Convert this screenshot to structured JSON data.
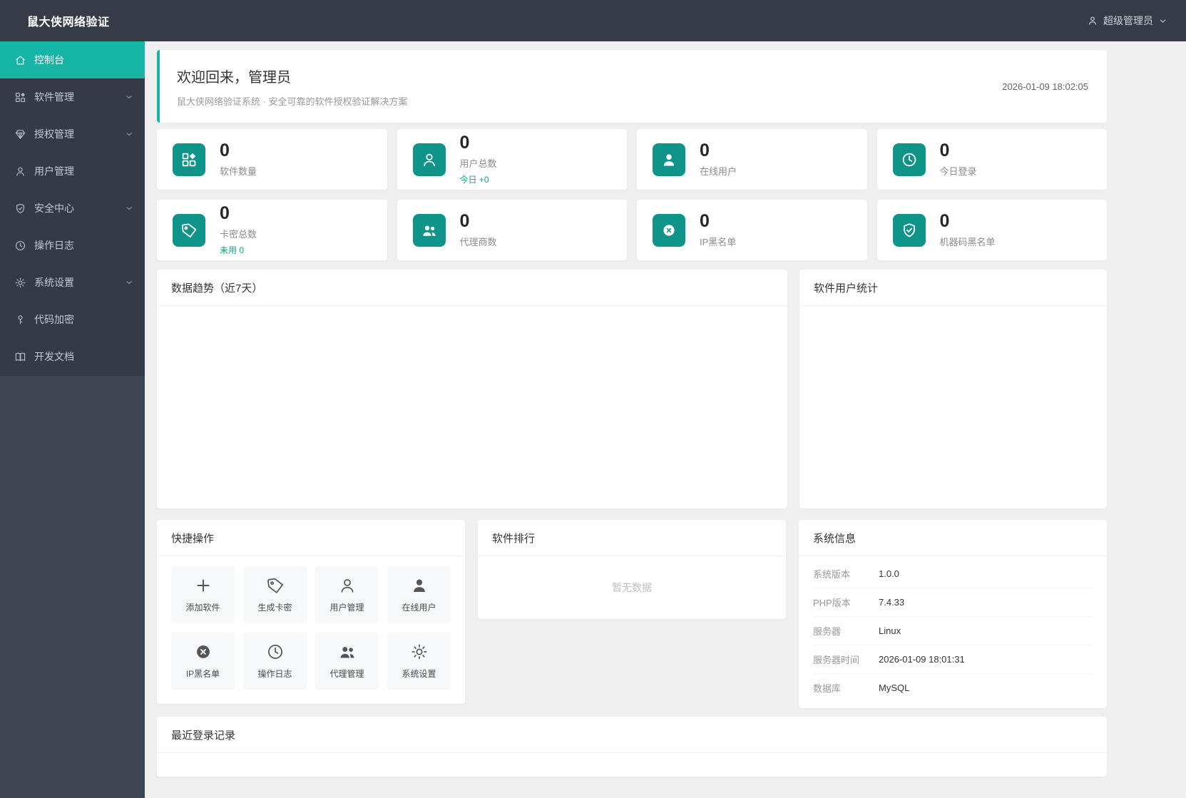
{
  "app": {
    "title": "鼠大侠网络验证"
  },
  "header": {
    "user_name": "超级管理员"
  },
  "sidebar": {
    "items": [
      {
        "label": "控制台"
      },
      {
        "label": "软件管理"
      },
      {
        "label": "授权管理"
      },
      {
        "label": "用户管理"
      },
      {
        "label": "安全中心"
      },
      {
        "label": "操作日志"
      },
      {
        "label": "系统设置"
      },
      {
        "label": "代码加密"
      },
      {
        "label": "开发文档"
      }
    ]
  },
  "welcome": {
    "title": "欢迎回来，管理员",
    "subtitle": "鼠大侠网络验证系统 · 安全可靠的软件授权验证解决方案",
    "datetime": "2026-01-09 18:02:05"
  },
  "stats": [
    {
      "value": "0",
      "label": "软件数量",
      "sub": ""
    },
    {
      "value": "0",
      "label": "用户总数",
      "sub": "今日 +0"
    },
    {
      "value": "0",
      "label": "在线用户",
      "sub": ""
    },
    {
      "value": "0",
      "label": "今日登录",
      "sub": ""
    },
    {
      "value": "0",
      "label": "卡密总数",
      "sub": "未用 0"
    },
    {
      "value": "0",
      "label": "代理商数",
      "sub": ""
    },
    {
      "value": "0",
      "label": "IP黑名单",
      "sub": ""
    },
    {
      "value": "0",
      "label": "机器码黑名单",
      "sub": ""
    }
  ],
  "trend_panel": {
    "title": "数据趋势（近7天）"
  },
  "software_users_panel": {
    "title": "软件用户统计"
  },
  "quick_actions": {
    "title": "快捷操作",
    "items": [
      {
        "label": "添加软件"
      },
      {
        "label": "生成卡密"
      },
      {
        "label": "用户管理"
      },
      {
        "label": "在线用户"
      },
      {
        "label": "IP黑名单"
      },
      {
        "label": "操作日志"
      },
      {
        "label": "代理管理"
      },
      {
        "label": "系统设置"
      }
    ]
  },
  "ranking_panel": {
    "title": "软件排行",
    "empty_text": "暂无数据"
  },
  "system_info": {
    "title": "系统信息",
    "rows": [
      {
        "label": "系统版本",
        "value": "1.0.0"
      },
      {
        "label": "PHP版本",
        "value": "7.4.33"
      },
      {
        "label": "服务器",
        "value": "Linux"
      },
      {
        "label": "服务器时间",
        "value": "2026-01-09 18:01:31"
      },
      {
        "label": "数据库",
        "value": "MySQL"
      }
    ]
  },
  "recent_logins": {
    "title": "最近登录记录"
  },
  "colors": {
    "accent": "#17b5a5",
    "icon_teal": "#0e9488",
    "green_text": "#13a184"
  }
}
